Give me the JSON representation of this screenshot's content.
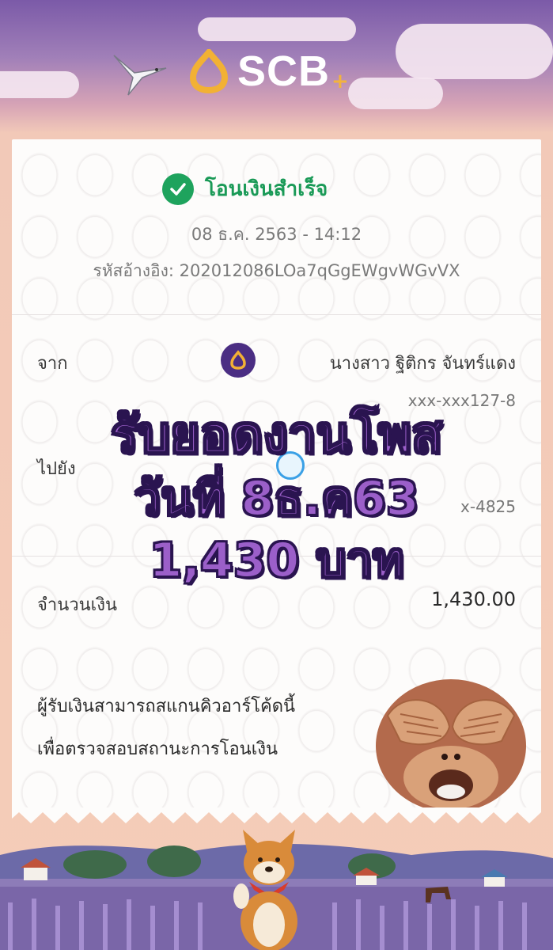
{
  "brand": {
    "name": "SCB",
    "plus": "+",
    "accent": "#4b2e83",
    "success_color": "#1ea35d"
  },
  "status": {
    "text": "โอนเงินสำเร็จ",
    "datetime": "08 ธ.ค. 2563 - 14:12",
    "reference": "รหัสอ้างอิง: 202012086LOa7qGgEWgvWGvVX"
  },
  "from": {
    "label": "จาก",
    "name": "นางสาว ฐิติกร จันทร์แดง",
    "account": "xxx-xxx127-8"
  },
  "to": {
    "label": "ไปยัง",
    "account": "x-4825"
  },
  "amount": {
    "label": "จำนวนเงิน",
    "value": "1,430.00"
  },
  "overlay": {
    "line1": "รับยอดงานโพส",
    "line2": "วันที่ 8ธ.ค63",
    "line3": "1,430 บาท"
  },
  "qr_note": {
    "line1": "ผู้รับเงินสามารถสแกนคิวอาร์โค้ดนี้",
    "line2": "เพื่อตรวจสอบสถานะการโอนเงิน"
  },
  "icons": [
    "scb-logo-icon",
    "bird-icon",
    "check-icon",
    "scb-avatar-icon",
    "promptpay-avatar-icon",
    "monkey-emoji-icon",
    "shiba-dog-icon"
  ]
}
